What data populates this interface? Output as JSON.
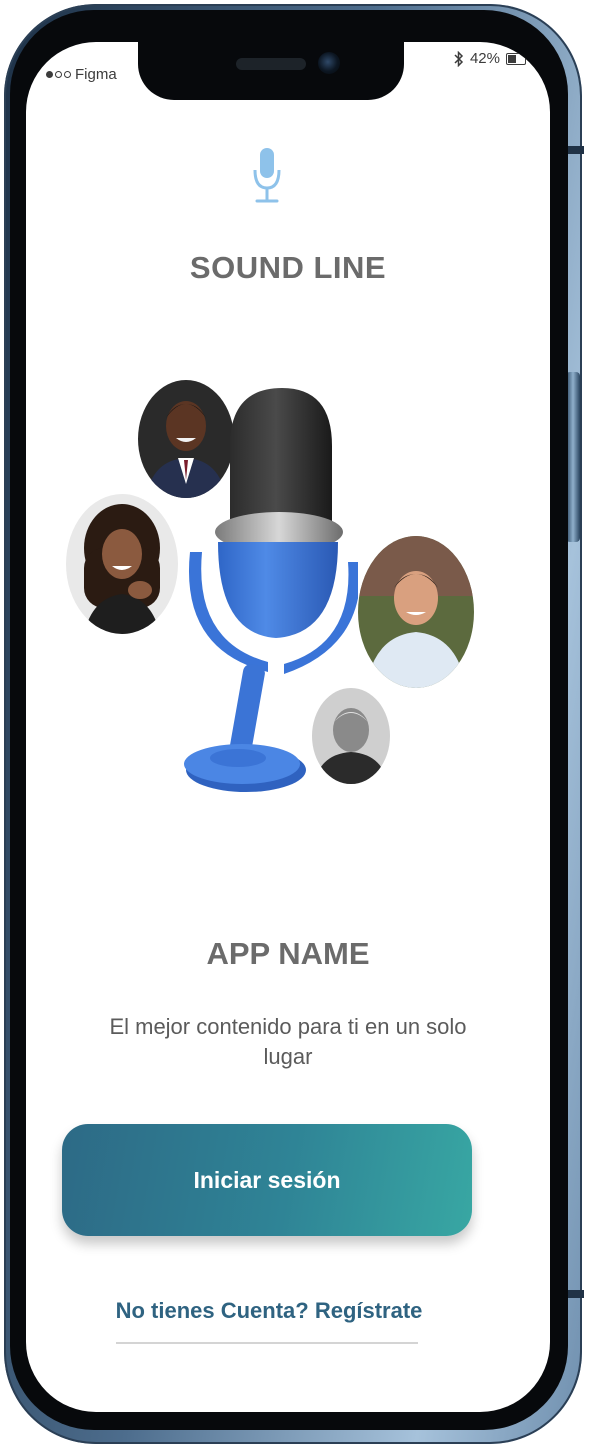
{
  "status_bar": {
    "carrier": "Figma",
    "battery": "42%"
  },
  "header": {
    "brand_title": "SOUND LINE"
  },
  "hero": {
    "illustration": "microphone-illustration",
    "avatars": [
      "avatar-man-suit",
      "avatar-woman-curly",
      "avatar-man-shirt",
      "avatar-older-man"
    ]
  },
  "main": {
    "app_name": "APP NAME",
    "tagline": "El mejor contenido para ti en un solo lugar",
    "login_label": "Iniciar sesión",
    "register_label": "No tienes Cuenta? Regístrate"
  },
  "colors": {
    "accent_start": "#2d6a86",
    "accent_end": "#38a7a3",
    "mic_icon": "#8ec2ea",
    "link": "#2f6381",
    "title": "#6b6b6b"
  }
}
